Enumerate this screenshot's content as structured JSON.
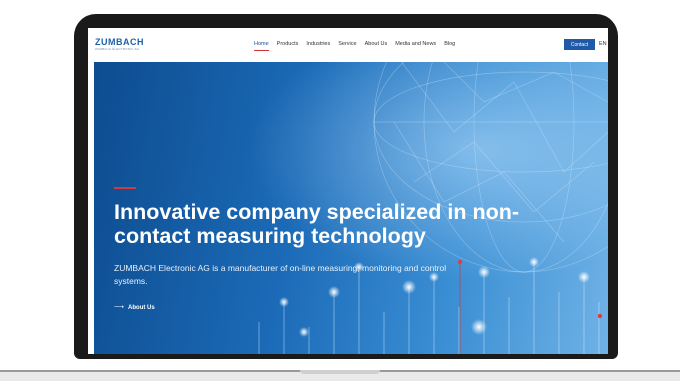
{
  "logo": {
    "name": "ZUMBACH",
    "tagline": "ZUMBACH ELECTRONIC AG"
  },
  "nav": {
    "items": [
      "Home",
      "Products",
      "Industries",
      "Service",
      "About Us",
      "Media and News",
      "Blog"
    ],
    "active": "Home",
    "contact_label": "Contact",
    "language": "EN"
  },
  "hero": {
    "headline": "Innovative company specialized in non-contact measuring technology",
    "subtext": "ZUMBACH Electronic AG is a manufacturer of on-line measuring, monitoring and control systems.",
    "link_label": "About Us",
    "link_icon": "arrow-right-icon"
  },
  "colors": {
    "brand": "#1f5fa8",
    "contact_button": "#1e5aa8",
    "accent_red": "#d33a3a",
    "hero_dark": "#0d4c8f",
    "hero_light": "#6fb2e6"
  }
}
